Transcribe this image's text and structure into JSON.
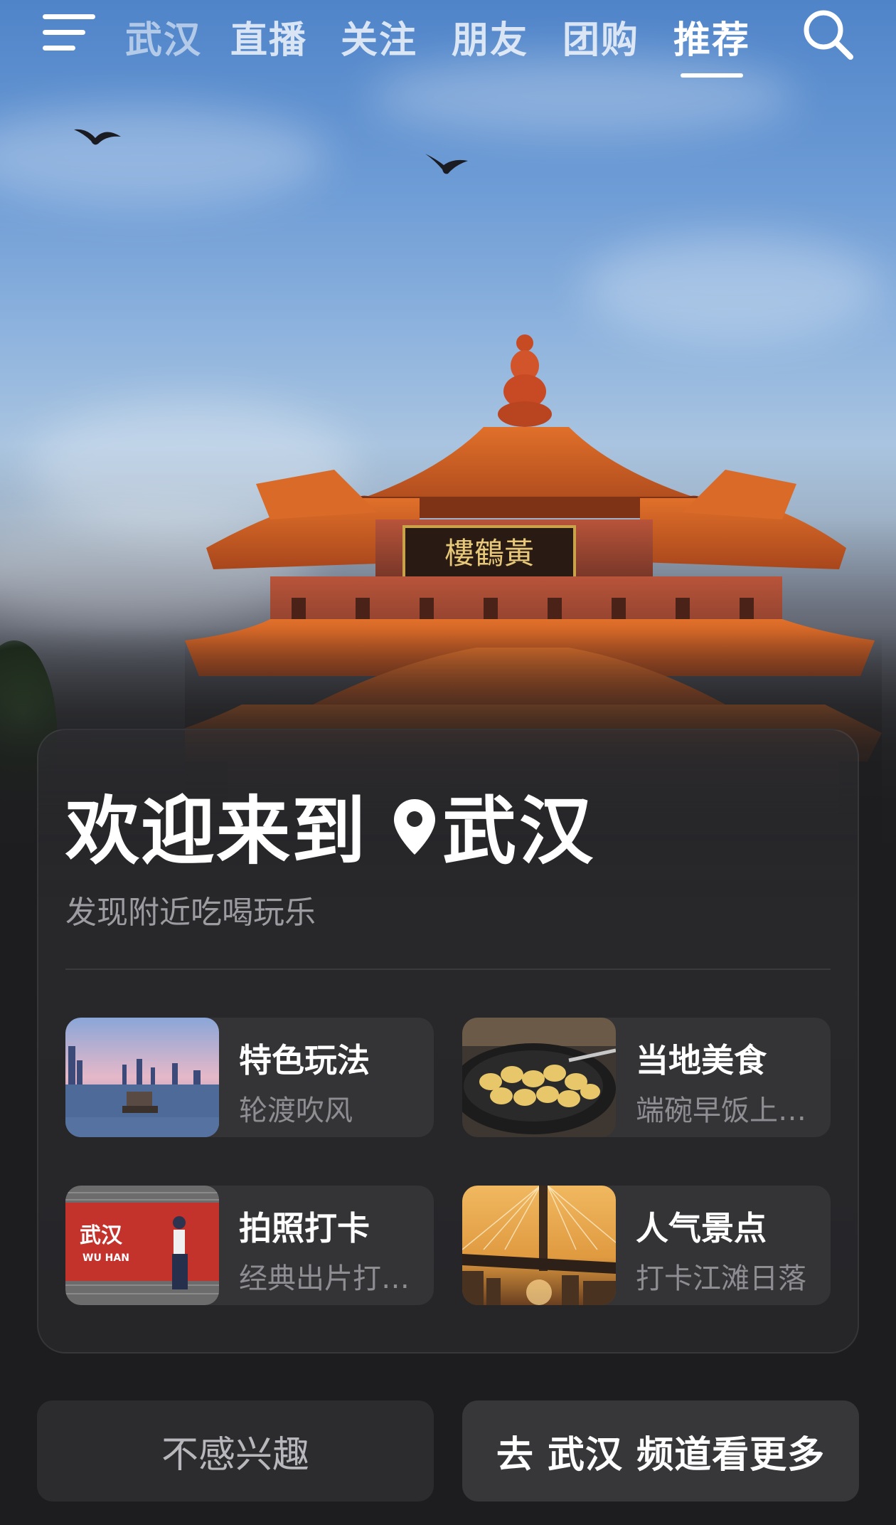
{
  "nav": {
    "tabs": [
      {
        "label": "武汉"
      },
      {
        "label": "直播"
      },
      {
        "label": "关注"
      },
      {
        "label": "朋友"
      },
      {
        "label": "团购"
      },
      {
        "label": "推荐",
        "active": true
      }
    ],
    "menu_icon": "menu-icon",
    "search_icon": "search-icon"
  },
  "hero": {
    "image": "Yellow Crane Tower (黄鹤楼) against blue sky with flying birds",
    "sign_text": "黄鹤楼"
  },
  "card": {
    "welcome": "欢迎来到",
    "city": "武汉",
    "pin_icon": "location-pin-icon",
    "subtitle": "发现附近吃喝玩乐",
    "items": [
      {
        "title": "特色玩法",
        "subtitle": "轮渡吹风",
        "thumb": "ferry-skyline-thumbnail"
      },
      {
        "title": "当地美食",
        "subtitle": "端碗早饭上…",
        "thumb": "dumplings-pan-thumbnail"
      },
      {
        "title": "拍照打卡",
        "subtitle": "经典出片打…",
        "thumb": "wuhan-wall-photo-thumbnail",
        "thumb_text": "武汉",
        "thumb_text2": "WU HAN"
      },
      {
        "title": "人气景点",
        "subtitle": "打卡江滩日落",
        "thumb": "bridge-sunset-thumbnail"
      }
    ]
  },
  "buttons": {
    "not_interested": "不感兴趣",
    "see_more": "去 武汉 频道看更多"
  },
  "colors": {
    "background": "#1d1d1f",
    "card": "#28282b",
    "item": "#343437",
    "muted_text": "#8d8d92",
    "roof_orange": "#d9661f"
  }
}
